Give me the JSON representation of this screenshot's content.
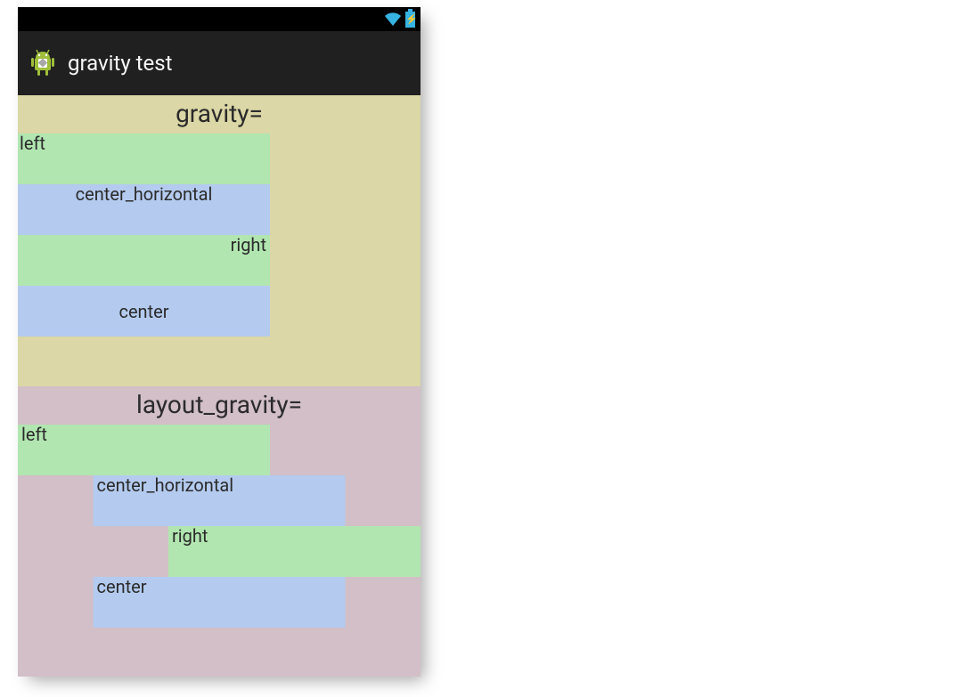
{
  "statusBar": {
    "wifiIcon": "wifi-icon",
    "batteryIcon": "battery-charging-icon"
  },
  "actionBar": {
    "iconName": "app-icon",
    "title": "gravity test"
  },
  "sections": {
    "gravity": {
      "title": "gravity=",
      "items": [
        {
          "label": "left",
          "gravity": "left",
          "color": "green"
        },
        {
          "label": "center_horizontal",
          "gravity": "center_horizontal",
          "color": "blue"
        },
        {
          "label": "right",
          "gravity": "right",
          "color": "green"
        },
        {
          "label": "center",
          "gravity": "center",
          "color": "blue"
        }
      ]
    },
    "layoutGravity": {
      "title": "layout_gravity=",
      "items": [
        {
          "label": "left",
          "layout_gravity": "left",
          "color": "green"
        },
        {
          "label": "center_horizontal",
          "layout_gravity": "center_horizontal",
          "color": "blue"
        },
        {
          "label": "right",
          "layout_gravity": "right",
          "color": "green"
        },
        {
          "label": "center",
          "layout_gravity": "center",
          "color": "blue"
        }
      ]
    }
  }
}
